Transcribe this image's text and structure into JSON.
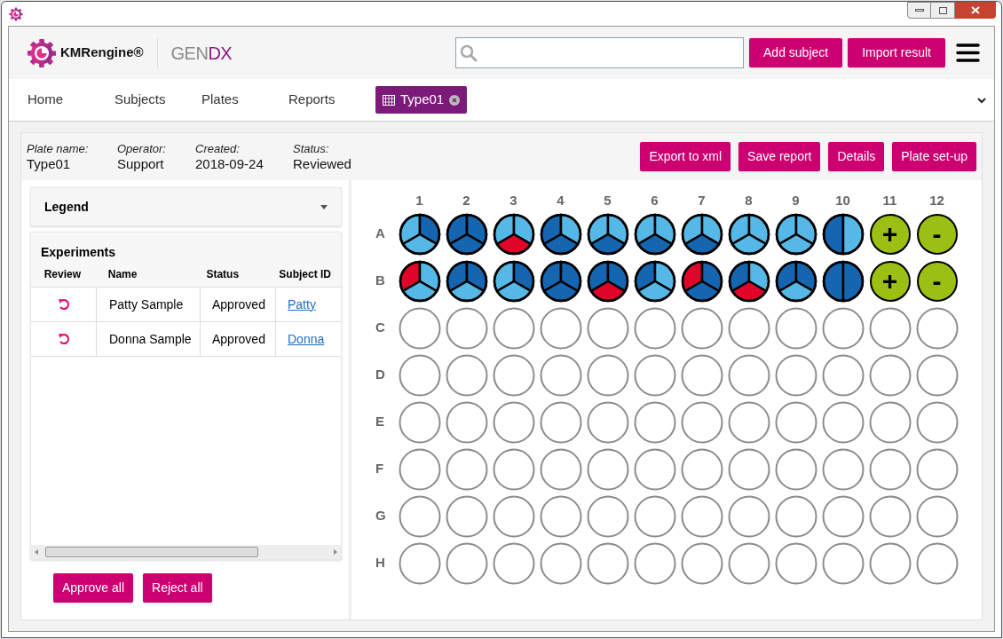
{
  "header": {
    "brand": "KMRengine®",
    "product_gray": "GEN",
    "product_accent": "DX",
    "buttons": [
      "Add subject",
      "Import result"
    ]
  },
  "nav": [
    {
      "label": "Home",
      "selected": false,
      "kind": "link"
    },
    {
      "label": "Subjects",
      "selected": false,
      "kind": "link"
    },
    {
      "label": "Plates",
      "selected": false,
      "kind": "link"
    },
    {
      "label": "Reports",
      "selected": false,
      "kind": "link"
    },
    {
      "label": "Type01",
      "selected": true,
      "kind": "tab"
    }
  ],
  "info": [
    {
      "label": "Plate name:",
      "value": "Type01"
    },
    {
      "label": "Operator:",
      "value": "Support"
    },
    {
      "label": "Created:",
      "value": "2018-09-24"
    },
    {
      "label": "Status:",
      "value": "Reviewed"
    }
  ],
  "actions": [
    "Export to xml",
    "Save report",
    "Details",
    "Plate set-up"
  ],
  "legend": {
    "title": "Legend",
    "expanded": false
  },
  "experiments": {
    "title": "Experiments",
    "columns": [
      "Review",
      "Name",
      "Status",
      "Subject ID"
    ],
    "rows": [
      {
        "name": "Patty Sample",
        "status": "Approved",
        "subject": "Patty"
      },
      {
        "name": "Donna Sample",
        "status": "Approved",
        "subject": "Donna"
      }
    ],
    "buttons": [
      "Approve all",
      "Reject all"
    ]
  },
  "plate": {
    "columns": [
      "1",
      "2",
      "3",
      "4",
      "5",
      "6",
      "7",
      "8",
      "9",
      "10",
      "11",
      "12"
    ],
    "rows": [
      {
        "label": "A",
        "wells": [
          {
            "kind": "three",
            "segments": [
              {
                "color": "#55b8e6"
              },
              {
                "color": "#1565b0"
              },
              {
                "color": "#55b8e6"
              }
            ]
          },
          {
            "kind": "three",
            "segments": [
              {
                "color": "#1565b0"
              },
              {
                "color": "#1565b0"
              },
              {
                "color": "#1565b0"
              }
            ]
          },
          {
            "kind": "three",
            "segments": [
              {
                "color": "#55b8e6"
              },
              {
                "color": "#55b8e6"
              },
              {
                "color": "#e2052a"
              }
            ]
          },
          {
            "kind": "three",
            "segments": [
              {
                "color": "#1565b0"
              },
              {
                "color": "#55b8e6"
              },
              {
                "color": "#1565b0"
              }
            ]
          },
          {
            "kind": "three",
            "segments": [
              {
                "color": "#55b8e6"
              },
              {
                "color": "#55b8e6"
              },
              {
                "color": "#1565b0"
              }
            ]
          },
          {
            "kind": "three",
            "segments": [
              {
                "color": "#55b8e6"
              },
              {
                "color": "#55b8e6"
              },
              {
                "color": "#1565b0"
              }
            ]
          },
          {
            "kind": "three",
            "segments": [
              {
                "color": "#55b8e6"
              },
              {
                "color": "#55b8e6"
              },
              {
                "color": "#1565b0"
              }
            ]
          },
          {
            "kind": "three",
            "segments": [
              {
                "color": "#55b8e6"
              },
              {
                "color": "#55b8e6"
              },
              {
                "color": "#55b8e6"
              }
            ]
          },
          {
            "kind": "three",
            "segments": [
              {
                "color": "#55b8e6"
              },
              {
                "color": "#55b8e6"
              },
              {
                "color": "#55b8e6"
              }
            ]
          },
          {
            "kind": "half",
            "segments": [
              {
                "color": "#1565b0"
              },
              {
                "color": "#55b8e6"
              }
            ]
          },
          {
            "kind": "control",
            "label": "+",
            "color": "#9bbf12"
          },
          {
            "kind": "control",
            "label": "-",
            "color": "#9bbf12"
          }
        ]
      },
      {
        "label": "B",
        "wells": [
          {
            "kind": "three",
            "segments": [
              {
                "color": "#e2052a"
              },
              {
                "color": "#55b8e6"
              },
              {
                "color": "#55b8e6"
              }
            ]
          },
          {
            "kind": "three",
            "segments": [
              {
                "color": "#1565b0"
              },
              {
                "color": "#1565b0"
              },
              {
                "color": "#55b8e6"
              }
            ]
          },
          {
            "kind": "three",
            "segments": [
              {
                "color": "#55b8e6"
              },
              {
                "color": "#1565b0"
              },
              {
                "color": "#55b8e6"
              }
            ]
          },
          {
            "kind": "three",
            "segments": [
              {
                "color": "#1565b0"
              },
              {
                "color": "#1565b0"
              },
              {
                "color": "#1565b0"
              }
            ]
          },
          {
            "kind": "three",
            "segments": [
              {
                "color": "#1565b0"
              },
              {
                "color": "#1565b0"
              },
              {
                "color": "#e2052a"
              }
            ]
          },
          {
            "kind": "three",
            "segments": [
              {
                "color": "#1565b0"
              },
              {
                "color": "#55b8e6"
              },
              {
                "color": "#55b8e6"
              }
            ]
          },
          {
            "kind": "three",
            "segments": [
              {
                "color": "#e2052a"
              },
              {
                "color": "#1565b0"
              },
              {
                "color": "#1565b0"
              }
            ]
          },
          {
            "kind": "three",
            "segments": [
              {
                "color": "#1565b0"
              },
              {
                "color": "#55b8e6"
              },
              {
                "color": "#e2052a"
              }
            ]
          },
          {
            "kind": "three",
            "segments": [
              {
                "color": "#1565b0"
              },
              {
                "color": "#1565b0"
              },
              {
                "color": "#55b8e6"
              }
            ]
          },
          {
            "kind": "half",
            "segments": [
              {
                "color": "#1565b0"
              },
              {
                "color": "#1565b0"
              }
            ]
          },
          {
            "kind": "control",
            "label": "+",
            "color": "#9bbf12"
          },
          {
            "kind": "control",
            "label": "-",
            "color": "#9bbf12"
          }
        ]
      },
      {
        "label": "C",
        "wells": [
          {
            "kind": "empty"
          },
          {
            "kind": "empty"
          },
          {
            "kind": "empty"
          },
          {
            "kind": "empty"
          },
          {
            "kind": "empty"
          },
          {
            "kind": "empty"
          },
          {
            "kind": "empty"
          },
          {
            "kind": "empty"
          },
          {
            "kind": "empty"
          },
          {
            "kind": "empty"
          },
          {
            "kind": "empty"
          },
          {
            "kind": "empty"
          }
        ]
      },
      {
        "label": "D",
        "wells": [
          {
            "kind": "empty"
          },
          {
            "kind": "empty"
          },
          {
            "kind": "empty"
          },
          {
            "kind": "empty"
          },
          {
            "kind": "empty"
          },
          {
            "kind": "empty"
          },
          {
            "kind": "empty"
          },
          {
            "kind": "empty"
          },
          {
            "kind": "empty"
          },
          {
            "kind": "empty"
          },
          {
            "kind": "empty"
          },
          {
            "kind": "empty"
          }
        ]
      },
      {
        "label": "E",
        "wells": [
          {
            "kind": "empty"
          },
          {
            "kind": "empty"
          },
          {
            "kind": "empty"
          },
          {
            "kind": "empty"
          },
          {
            "kind": "empty"
          },
          {
            "kind": "empty"
          },
          {
            "kind": "empty"
          },
          {
            "kind": "empty"
          },
          {
            "kind": "empty"
          },
          {
            "kind": "empty"
          },
          {
            "kind": "empty"
          },
          {
            "kind": "empty"
          }
        ]
      },
      {
        "label": "F",
        "wells": [
          {
            "kind": "empty"
          },
          {
            "kind": "empty"
          },
          {
            "kind": "empty"
          },
          {
            "kind": "empty"
          },
          {
            "kind": "empty"
          },
          {
            "kind": "empty"
          },
          {
            "kind": "empty"
          },
          {
            "kind": "empty"
          },
          {
            "kind": "empty"
          },
          {
            "kind": "empty"
          },
          {
            "kind": "empty"
          },
          {
            "kind": "empty"
          }
        ]
      },
      {
        "label": "G",
        "wells": [
          {
            "kind": "empty"
          },
          {
            "kind": "empty"
          },
          {
            "kind": "empty"
          },
          {
            "kind": "empty"
          },
          {
            "kind": "empty"
          },
          {
            "kind": "empty"
          },
          {
            "kind": "empty"
          },
          {
            "kind": "empty"
          },
          {
            "kind": "empty"
          },
          {
            "kind": "empty"
          },
          {
            "kind": "empty"
          },
          {
            "kind": "empty"
          }
        ]
      },
      {
        "label": "H",
        "wells": [
          {
            "kind": "empty"
          },
          {
            "kind": "empty"
          },
          {
            "kind": "empty"
          },
          {
            "kind": "empty"
          },
          {
            "kind": "empty"
          },
          {
            "kind": "empty"
          },
          {
            "kind": "empty"
          },
          {
            "kind": "empty"
          },
          {
            "kind": "empty"
          },
          {
            "kind": "empty"
          },
          {
            "kind": "empty"
          },
          {
            "kind": "empty"
          }
        ]
      }
    ]
  }
}
